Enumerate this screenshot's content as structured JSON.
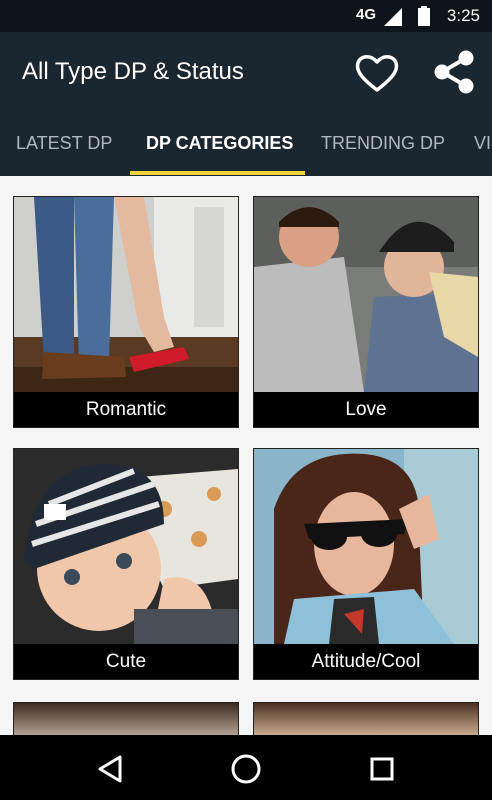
{
  "status_bar": {
    "network": "4G",
    "time": "3:25"
  },
  "app_bar": {
    "title": "All Type DP & Status"
  },
  "tabs": [
    {
      "label": "LATEST DP"
    },
    {
      "label": "DP CATEGORIES"
    },
    {
      "label": "TRENDING DP"
    },
    {
      "label": "VI"
    }
  ],
  "categories": [
    {
      "label": "Romantic"
    },
    {
      "label": "Love"
    },
    {
      "label": "Cute"
    },
    {
      "label": "Attitude/Cool"
    }
  ],
  "colors": {
    "app_bar": "#1b2730",
    "tab_indicator": "#f3d33a",
    "status_bar": "#0e141a"
  }
}
